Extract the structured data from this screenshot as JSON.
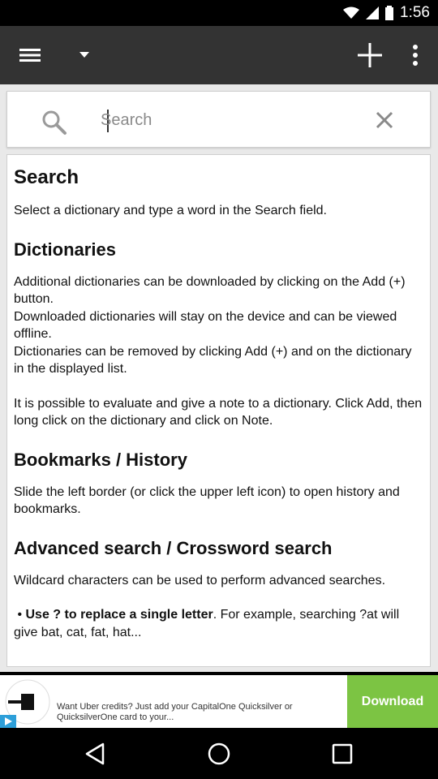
{
  "status_bar": {
    "time": "1:56"
  },
  "toolbar": {
    "menu_icon": "hamburger-icon",
    "dropdown_icon": "caret-down-icon",
    "add_icon": "plus-icon",
    "overflow_icon": "more-vert-icon"
  },
  "search": {
    "placeholder": "Search",
    "value": "",
    "search_icon": "magnifier-icon",
    "clear_icon": "close-icon"
  },
  "help": {
    "title": "Search",
    "intro": "Select a dictionary and type a word in the Search field.",
    "dictionaries_heading": "Dictionaries",
    "dictionaries_p1": "Additional dictionaries can be downloaded by clicking on the Add (+) button.",
    "dictionaries_p2": "Downloaded dictionaries will stay on the device and can be viewed offline.",
    "dictionaries_p3": "Dictionaries can be removed by clicking Add (+) and on the dictionary in the displayed list.",
    "dictionaries_p4": "It is possible to evaluate and give a note to a dictionary. Click Add, then long click on the dictionary and click on Note.",
    "bookmarks_heading": "Bookmarks / History",
    "bookmarks_p": "Slide the left border (or click the upper left icon) to open history and bookmarks.",
    "advanced_heading": "Advanced search / Crossword search",
    "advanced_p": "Wildcard characters can be used to perform advanced searches.",
    "bullet_bold": "Use ? to replace a single letter",
    "bullet_rest": ". For example, searching ?at will give bat, cat, fat, hat..."
  },
  "ad": {
    "text": "Want Uber credits? Just add your CapitalOne Quicksilver or QuicksilverOne card to your...",
    "download_label": "Download"
  },
  "colors": {
    "toolbar": "#333333",
    "background": "#e9e9e9",
    "ad_button": "#7cc443"
  }
}
